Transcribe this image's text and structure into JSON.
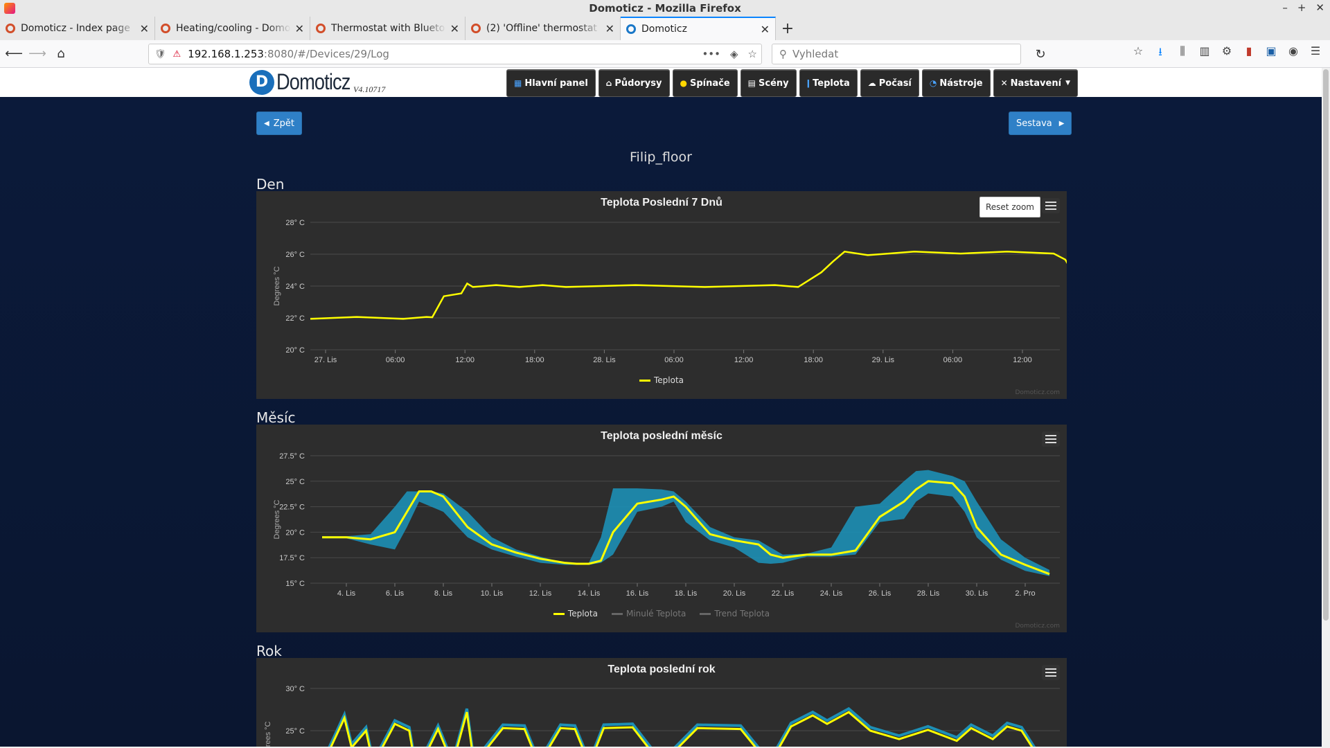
{
  "window": {
    "title": "Domoticz - Mozilla Firefox"
  },
  "tabs": [
    {
      "title": "Domoticz - Index page",
      "active": false
    },
    {
      "title": "Heating/cooling - Domo",
      "active": false
    },
    {
      "title": "Thermostat with Blueto",
      "active": false
    },
    {
      "title": "(2) 'Offline' thermostat",
      "active": false
    },
    {
      "title": "Domoticz",
      "active": true
    }
  ],
  "url": {
    "host": "192.168.1.253",
    "path": ":8080/#/Devices/29/Log"
  },
  "search": {
    "placeholder": "Vyhledat"
  },
  "app": {
    "logo_text": "Domoticz",
    "version": "V4.10717",
    "menu": [
      {
        "label": "Hlavní panel",
        "icon": "dashboard-icon"
      },
      {
        "label": "Půdorysy",
        "icon": "floorplan-icon"
      },
      {
        "label": "Spínače",
        "icon": "bulb-icon"
      },
      {
        "label": "Scény",
        "icon": "scene-icon"
      },
      {
        "label": "Teplota",
        "icon": "thermometer-icon"
      },
      {
        "label": "Počasí",
        "icon": "cloud-icon"
      },
      {
        "label": "Nástroje",
        "icon": "gauge-icon"
      },
      {
        "label": "Nastavení",
        "icon": "wrench-icon"
      }
    ]
  },
  "page": {
    "back_label": "Zpět",
    "report_label": "Sestava",
    "device_name": "Filip_floor",
    "sections": {
      "day": "Den",
      "month": "Měsíc",
      "year": "Rok"
    },
    "reset_zoom": "Reset zoom",
    "credits": "Domoticz.com"
  },
  "chart_data": [
    {
      "type": "line",
      "title": "Teplota Poslední 7 Dnů",
      "ylabel": "Degrees °C",
      "ylim": [
        20,
        28
      ],
      "yticks": [
        "20° C",
        "22° C",
        "24° C",
        "26° C",
        "28° C"
      ],
      "xticks": [
        "27. Lis",
        "06:00",
        "12:00",
        "18:00",
        "28. Lis",
        "06:00",
        "12:00",
        "18:00",
        "29. Lis",
        "06:00",
        "12:00"
      ],
      "x_hours": [
        -4,
        0,
        4,
        6,
        6.5,
        7.5,
        9,
        9.5,
        10,
        12,
        14,
        16,
        18,
        24,
        30,
        36,
        38,
        40,
        41,
        42,
        44,
        48,
        52,
        56,
        60,
        61,
        61.5,
        62
      ],
      "series": [
        {
          "name": "Teplota",
          "color": "#ffff00",
          "values": [
            22.0,
            22.0,
            22.0,
            22.0,
            22.1,
            23.3,
            23.6,
            24.1,
            24.0,
            24.0,
            24.0,
            24.0,
            24.0,
            24.0,
            24.0,
            24.0,
            24.0,
            24.8,
            25.6,
            26.1,
            26.0,
            26.1,
            26.1,
            26.1,
            26.1,
            25.6,
            25.1,
            24.9
          ]
        }
      ],
      "legend": [
        "Teplota"
      ]
    },
    {
      "type": "line",
      "title": "Teplota poslední měsíc",
      "ylabel": "Degrees °C",
      "ylim": [
        15,
        27.5
      ],
      "yticks": [
        "15° C",
        "17.5° C",
        "20° C",
        "22.5° C",
        "25° C",
        "27.5° C"
      ],
      "xticks": [
        "4. Lis",
        "6. Lis",
        "8. Lis",
        "10. Lis",
        "12. Lis",
        "14. Lis",
        "16. Lis",
        "18. Lis",
        "20. Lis",
        "22. Lis",
        "24. Lis",
        "26. Lis",
        "28. Lis",
        "30. Lis",
        "2. Pro"
      ],
      "x_days": [
        3,
        4,
        5,
        6,
        6.5,
        7,
        7.5,
        8,
        9,
        10,
        11,
        12,
        13,
        13.5,
        14,
        14.5,
        15,
        16,
        17,
        17.5,
        18,
        19,
        20,
        21,
        21.5,
        22,
        23,
        24,
        25,
        26,
        27,
        27.5,
        28,
        29,
        29.5,
        30,
        31,
        32,
        33
      ],
      "series": [
        {
          "name": "Teplota",
          "color": "#ffff00",
          "values": [
            19.5,
            19.5,
            19.3,
            20.0,
            22.0,
            24.0,
            24.0,
            23.5,
            20.5,
            18.8,
            18.0,
            17.4,
            17.0,
            16.9,
            16.9,
            17.2,
            20.0,
            22.8,
            23.2,
            23.5,
            22.5,
            19.8,
            19.2,
            18.8,
            17.8,
            17.5,
            17.8,
            17.8,
            18.2,
            21.5,
            23.0,
            24.2,
            25.0,
            24.8,
            23.5,
            20.5,
            17.8,
            16.8,
            15.9
          ]
        },
        {
          "name": "Minulé Teplota",
          "visible": false
        },
        {
          "name": "Trend Teplota",
          "color": "#1d8fb5",
          "upper": [
            19.6,
            19.6,
            19.8,
            22.5,
            24.0,
            24.0,
            24.0,
            23.8,
            22.0,
            19.5,
            18.3,
            17.6,
            17.0,
            16.9,
            17.0,
            19.5,
            24.3,
            24.3,
            24.2,
            24.0,
            23.0,
            20.5,
            19.5,
            19.2,
            18.5,
            17.8,
            17.9,
            18.5,
            22.5,
            22.8,
            25.0,
            26.0,
            26.1,
            25.5,
            25.0,
            23.0,
            19.3,
            17.5,
            16.3
          ],
          "lower": [
            19.4,
            19.4,
            18.8,
            18.3,
            20.5,
            23.0,
            22.5,
            22.0,
            19.5,
            18.3,
            17.6,
            17.0,
            16.8,
            16.8,
            16.8,
            17.0,
            17.8,
            22.0,
            22.5,
            23.0,
            21.0,
            19.2,
            18.5,
            17.0,
            16.9,
            17.0,
            17.6,
            17.6,
            17.8,
            21.0,
            21.3,
            23.0,
            23.8,
            23.5,
            22.0,
            19.5,
            17.3,
            16.2,
            15.7
          ]
        }
      ],
      "legend": [
        "Teplota",
        "Minulé Teplota",
        "Trend Teplota"
      ]
    },
    {
      "type": "line",
      "title": "Teplota poslední rok",
      "ylabel": "Degrees °C",
      "yticks": [
        "25° C",
        "30° C"
      ],
      "x_index": [
        0,
        3,
        4,
        6,
        7,
        10,
        12,
        13,
        16,
        18,
        20,
        21,
        25,
        28,
        30,
        33,
        35,
        37,
        39,
        43,
        47,
        52,
        58,
        62,
        65,
        68,
        70,
        73,
        76,
        80,
        84,
        88,
        90,
        93,
        95,
        97,
        100
      ],
      "series": [
        {
          "name": "Teplota",
          "color": "#ffff00",
          "values": [
            21,
            26.5,
            23,
            25,
            21,
            25.8,
            25,
            20,
            25.2,
            21,
            27.2,
            21,
            25.3,
            25.2,
            21,
            25.3,
            25.2,
            21,
            25.3,
            25.4,
            21,
            25.3,
            25.2,
            21,
            25.5,
            26.8,
            25.8,
            27.2,
            25.0,
            24.0,
            25.1,
            23.8,
            25.3,
            24.0,
            25.5,
            25.0,
            21
          ]
        }
      ]
    }
  ]
}
